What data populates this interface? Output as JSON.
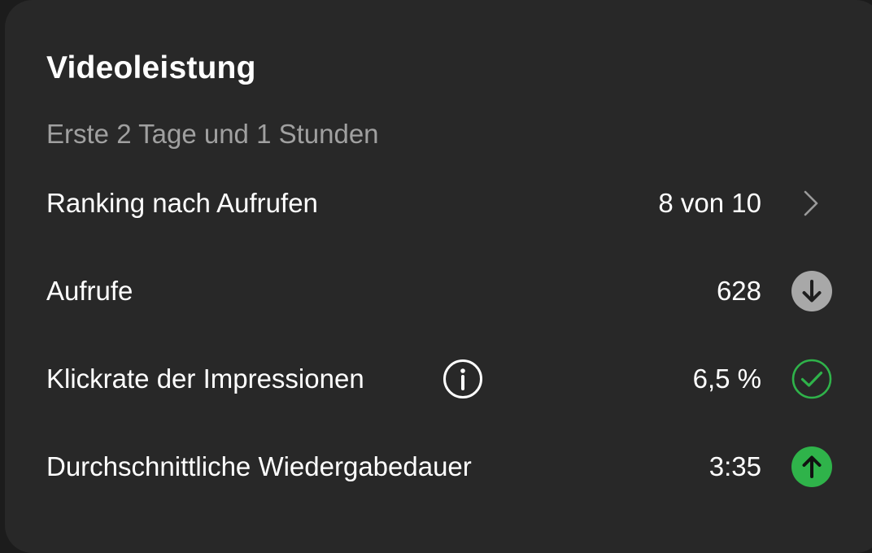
{
  "card": {
    "title": "Videoleistung",
    "subtitle": "Erste 2 Tage und 1 Stunden"
  },
  "rows": [
    {
      "label": "Ranking nach Aufrufen",
      "value": "8 von 10",
      "icon": "chevron-right-icon"
    },
    {
      "label": "Aufrufe",
      "value": "628",
      "icon": "arrow-down-circle-icon"
    },
    {
      "label": "Klickrate der Impressionen",
      "value": "6,5 %",
      "icon": "check-circle-icon",
      "info_icon": "info-icon"
    },
    {
      "label": "Durchschnittliche Wiedergabedauer",
      "value": "3:35",
      "icon": "arrow-up-circle-icon"
    }
  ],
  "colors": {
    "background": "#282828",
    "text_primary": "#ffffff",
    "text_secondary": "#a0a0a0",
    "down_badge": "#a8a8a8",
    "check_green": "#2fb34a",
    "up_green": "#2fb34a"
  }
}
